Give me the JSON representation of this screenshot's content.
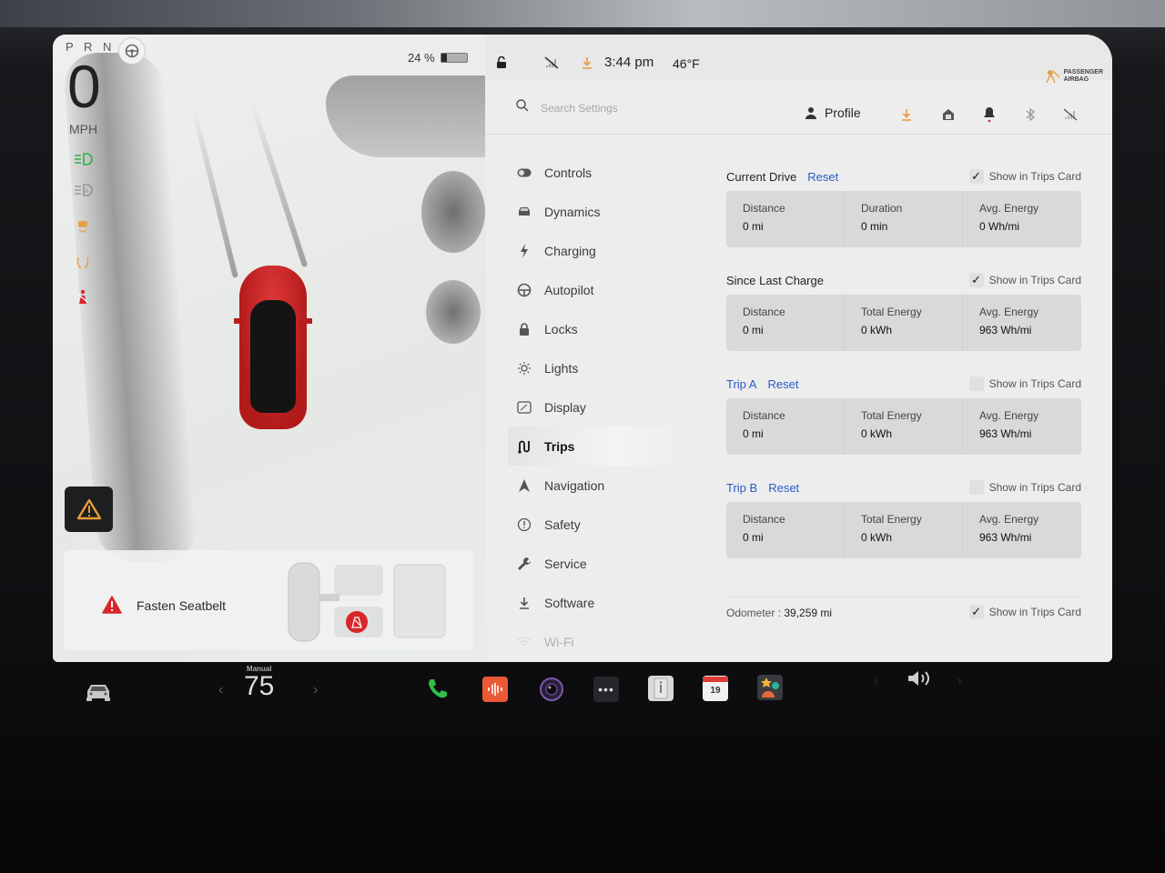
{
  "status": {
    "gear": "P R N D",
    "speed": "0",
    "speed_unit": "MPH",
    "battery_percent": "24 %",
    "battery_level": 0.24,
    "time": "3:44 pm",
    "temperature": "46°F",
    "airbag_line1": "PASSENGER",
    "airbag_line2": "AIRBAG"
  },
  "alerts": {
    "seatbelt": "Fasten Seatbelt"
  },
  "settings": {
    "search_placeholder": "Search Settings",
    "profile_label": "Profile",
    "nav": [
      {
        "label": "Controls",
        "icon": "toggle-icon"
      },
      {
        "label": "Dynamics",
        "icon": "car-icon"
      },
      {
        "label": "Charging",
        "icon": "bolt-icon"
      },
      {
        "label": "Autopilot",
        "icon": "steering-wheel-icon"
      },
      {
        "label": "Locks",
        "icon": "lock-icon"
      },
      {
        "label": "Lights",
        "icon": "light-bulb-icon"
      },
      {
        "label": "Display",
        "icon": "display-icon"
      },
      {
        "label": "Trips",
        "icon": "route-icon",
        "active": true
      },
      {
        "label": "Navigation",
        "icon": "navigation-arrow-icon"
      },
      {
        "label": "Safety",
        "icon": "safety-icon"
      },
      {
        "label": "Service",
        "icon": "wrench-icon"
      },
      {
        "label": "Software",
        "icon": "download-icon"
      },
      {
        "label": "Wi-Fi",
        "icon": "wifi-icon"
      }
    ],
    "trips": {
      "show_in_trips_card": "Show in Trips Card",
      "reset": "Reset",
      "current_drive": {
        "title": "Current Drive",
        "checked": true,
        "stats": [
          {
            "label": "Distance",
            "value": "0 mi"
          },
          {
            "label": "Duration",
            "value": "0 min"
          },
          {
            "label": "Avg. Energy",
            "value": "0 Wh/mi"
          }
        ]
      },
      "since_last_charge": {
        "title": "Since Last Charge",
        "checked": true,
        "stats": [
          {
            "label": "Distance",
            "value": "0 mi"
          },
          {
            "label": "Total Energy",
            "value": "0 kWh"
          },
          {
            "label": "Avg. Energy",
            "value": "963 Wh/mi"
          }
        ]
      },
      "trip_a": {
        "title": "Trip A",
        "checked": false,
        "stats": [
          {
            "label": "Distance",
            "value": "0 mi"
          },
          {
            "label": "Total Energy",
            "value": "0 kWh"
          },
          {
            "label": "Avg. Energy",
            "value": "963 Wh/mi"
          }
        ]
      },
      "trip_b": {
        "title": "Trip B",
        "checked": false,
        "stats": [
          {
            "label": "Distance",
            "value": "0 mi"
          },
          {
            "label": "Total Energy",
            "value": "0 kWh"
          },
          {
            "label": "Avg. Energy",
            "value": "963 Wh/mi"
          }
        ]
      },
      "odometer_label": "Odometer :",
      "odometer_value": "39,259 mi",
      "odometer_checked": true
    }
  },
  "taskbar": {
    "climate_mode": "Manual",
    "climate_temp": "75",
    "calendar_day": "19"
  },
  "colors": {
    "accent_link": "#2d59c9",
    "warning_red": "#d8262b",
    "indicator_green": "#2fae4e",
    "download_orange": "#e79a3c"
  }
}
